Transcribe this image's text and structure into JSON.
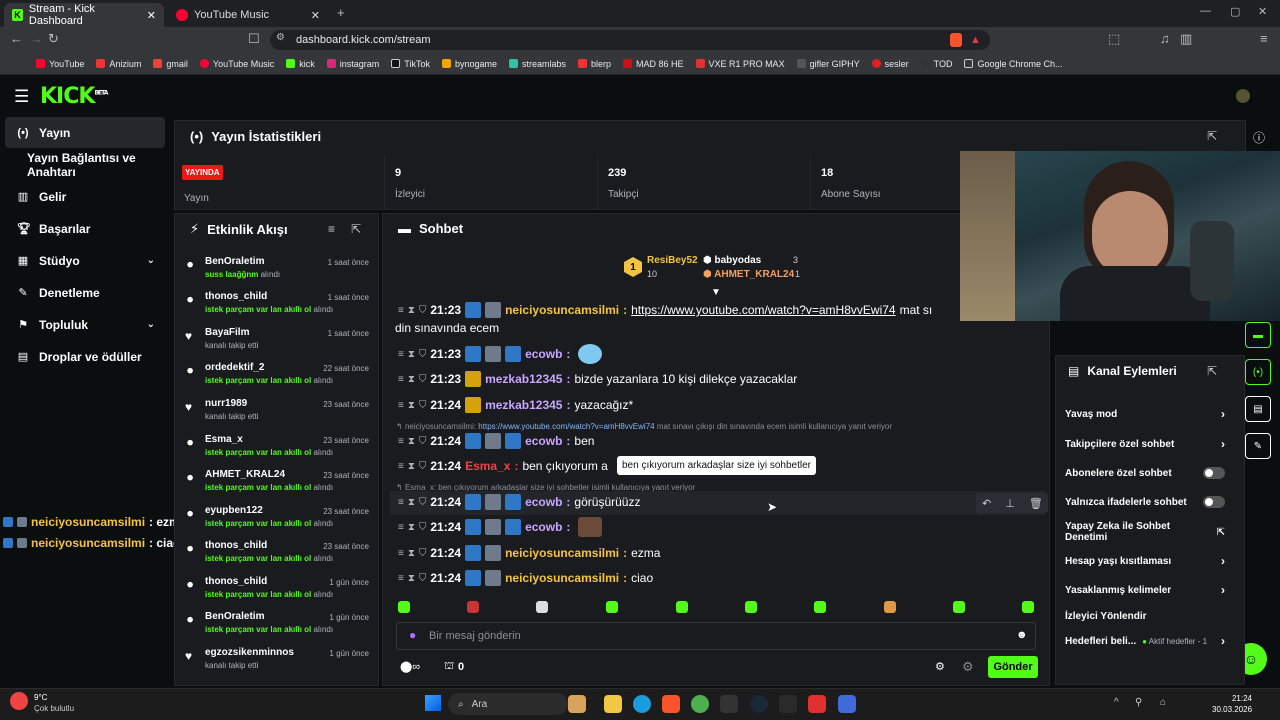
{
  "browser": {
    "tabs": [
      {
        "label": "Stream - Kick Dashboard"
      },
      {
        "label": "YouTube Music"
      }
    ],
    "url": "dashboard.kick.com/stream",
    "bookmarks": [
      "YouTube",
      "Anizium",
      "gmail",
      "YouTube Music",
      "kick",
      "instagram",
      "TikTok",
      "bynogame",
      "streamlabs",
      "blerp",
      "MAD 86 HE",
      "VXE R1 PRO MAX",
      "gifler GIPHY",
      "sesler",
      "TOD",
      "Google Chrome Ch..."
    ]
  },
  "kick": {
    "logo": "KICK",
    "logo_sup": "BETA"
  },
  "nav": {
    "items": [
      {
        "label": "Yayın"
      },
      {
        "label": "Yayın Bağlantısı ve Anahtarı"
      },
      {
        "label": "Gelir"
      },
      {
        "label": "Başarılar"
      },
      {
        "label": "Stüdyo"
      },
      {
        "label": "Denetleme"
      },
      {
        "label": "Topluluk"
      },
      {
        "label": "Droplar ve ödüller"
      }
    ]
  },
  "overlay": [
    {
      "user": "neiciyosuncamsilmi",
      "text": ": ezma"
    },
    {
      "user": "neiciyosuncamsilmi",
      "text": ": ciao"
    }
  ],
  "stats": {
    "title": "Yayın İstatistikleri",
    "live_badge": "YAYINDA",
    "cells": [
      {
        "value": "",
        "label": "Yayın"
      },
      {
        "value": "9",
        "label": "İzleyici"
      },
      {
        "value": "239",
        "label": "Takipçi"
      },
      {
        "value": "18",
        "label": "Abone Sayısı"
      }
    ]
  },
  "events": {
    "title": "Etkinlik Akışı",
    "items": [
      {
        "name": "BenOraletim",
        "time": "1 saat önce",
        "hl": "suss laağğnm",
        "rest": " alındı",
        "type": "redeem"
      },
      {
        "name": "thonos_child",
        "time": "1 saat önce",
        "hl": "istek parçam var lan akıllı ol",
        "rest": " alındı",
        "type": "redeem"
      },
      {
        "name": "BayaFilm",
        "time": "1 saat önce",
        "hl": "",
        "rest": "kanalı takip etti",
        "type": "follow"
      },
      {
        "name": "ordedektif_2",
        "time": "22 saat önce",
        "hl": "istek parçam var lan akıllı ol",
        "rest": " alındı",
        "type": "redeem"
      },
      {
        "name": "nurr1989",
        "time": "23 saat önce",
        "hl": "",
        "rest": "kanalı takip etti",
        "type": "follow"
      },
      {
        "name": "Esma_x",
        "time": "23 saat önce",
        "hl": "istek parçam var lan akıllı ol",
        "rest": " alındı",
        "type": "redeem"
      },
      {
        "name": "AHMET_KRAL24",
        "time": "23 saat önce",
        "hl": "istek parçam var lan akıllı ol",
        "rest": " alındı",
        "type": "redeem"
      },
      {
        "name": "eyupben122",
        "time": "23 saat önce",
        "hl": "istek parçam var lan akıllı ol",
        "rest": " alındı",
        "type": "redeem"
      },
      {
        "name": "thonos_child",
        "time": "23 saat önce",
        "hl": "istek parçam var lan akıllı ol",
        "rest": " alındı",
        "type": "redeem"
      },
      {
        "name": "thonos_child",
        "time": "1 gün önce",
        "hl": "istek parçam var lan akıllı ol",
        "rest": " alındı",
        "type": "redeem"
      },
      {
        "name": "BenOraletim",
        "time": "1 gün önce",
        "hl": "istek parçam var lan akıllı ol",
        "rest": " alındı",
        "type": "redeem"
      },
      {
        "name": "egzozsikenminnos",
        "time": "1 gün önce",
        "hl": "",
        "rest": "kanalı takip etti",
        "type": "follow"
      }
    ]
  },
  "chat": {
    "title": "Sohbet",
    "leaderboard": [
      {
        "rank": "1",
        "name": "ResiBey52",
        "count": "10"
      },
      {
        "name": "babyodas",
        "count": "3"
      },
      {
        "name": "AHMET_KRAL24",
        "count": "1"
      }
    ],
    "messages": [
      {
        "time": "21:23",
        "user": "neiciyosuncamsilmi",
        "color": "#f5c342",
        "link": "https://www.youtube.com/watch?v=amH8vvEwi74",
        "text": " mat sı",
        "cont": "din sınavında ecem"
      },
      {
        "time": "21:23",
        "user": "ecowb",
        "color": "#c9a6ff",
        "text": ""
      },
      {
        "time": "21:23",
        "user": "mezkab12345",
        "color": "#c9a6ff",
        "text": " bizde yazanlara 10 kişi dilekçe yazacaklar"
      },
      {
        "time": "21:24",
        "user": "mezkab12345",
        "color": "#c9a6ff",
        "text": " yazacağız*"
      },
      {
        "time": "21:24",
        "user": "ecowb",
        "color": "#c9a6ff",
        "text": " ben"
      },
      {
        "time": "21:24",
        "user": "Esma_x",
        "color": "#e8464a",
        "text": " ben çıkıyorum a"
      },
      {
        "time": "21:24",
        "user": "ecowb",
        "color": "#c9a6ff",
        "text": " görüşürüüzz"
      },
      {
        "time": "21:24",
        "user": "ecowb",
        "color": "#c9a6ff",
        "text": ""
      },
      {
        "time": "21:24",
        "user": "neiciyosuncamsilmi",
        "color": "#f5c342",
        "text": " ezma"
      },
      {
        "time": "21:24",
        "user": "neiciyosuncamsilmi",
        "color": "#f5c342",
        "text": " ciao"
      }
    ],
    "reply1_pre": "neiciyosuncamsilmi: ",
    "reply1_link": "https://www.youtube.com/watch?v=amH8vvEwi74",
    "reply1_post": " mat sınavı çıkışı din sınavında ecem isimli kullanıcıya yanıt veriyor",
    "reply2": "Esma_x: ben çıkıyorum arkadaşlar size iyi sohbetler isimli kullanıcıya yanıt veriyor",
    "tooltip": "ben çıkıyorum arkadaşlar size iyi sohbetler",
    "placeholder": "Bir mesaj gönderin",
    "points": "0",
    "send": "Gönder"
  },
  "actions": {
    "title": "Kanal Eylemleri",
    "items": [
      {
        "label": "Yavaş mod",
        "ctl": "chevron"
      },
      {
        "label": "Takipçilere özel sohbet",
        "ctl": "chevron"
      },
      {
        "label": "Abonelere özel sohbet",
        "ctl": "toggle"
      },
      {
        "label": "Yalnızca ifadelerle sohbet",
        "ctl": "toggle"
      },
      {
        "label": "Yapay Zeka ile Sohbet Denetimi",
        "ctl": "ext"
      },
      {
        "label": "Hesap yaşı kısıtlaması",
        "ctl": "chevron"
      },
      {
        "label": "Yasaklanmış kelimeler",
        "ctl": "chevron"
      },
      {
        "label": "İzleyici Yönlendir",
        "ctl": "none"
      },
      {
        "label": "Hedefleri beli...",
        "ctl": "chevron",
        "extra": "Aktif hedefler - 1"
      }
    ]
  },
  "taskbar": {
    "temp": "9°C",
    "weather": "Çok bulutlu",
    "search": "Ara",
    "time": "21:24",
    "date": "30.03.2026"
  },
  "colors": {
    "accent": "#53fc18",
    "bg": "#0b0e0f",
    "panel": "#191b1f"
  }
}
